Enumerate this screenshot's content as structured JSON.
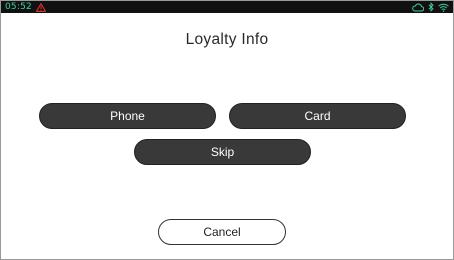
{
  "status_bar": {
    "time": "05:52",
    "warning_color": "#e0302a",
    "icon_color": "#3fd0a0",
    "icons": [
      "cloud-icon",
      "bluetooth-icon",
      "wifi-icon"
    ]
  },
  "screen": {
    "title": "Loyalty Info"
  },
  "buttons": {
    "phone": "Phone",
    "card": "Card",
    "skip": "Skip",
    "cancel": "Cancel"
  }
}
